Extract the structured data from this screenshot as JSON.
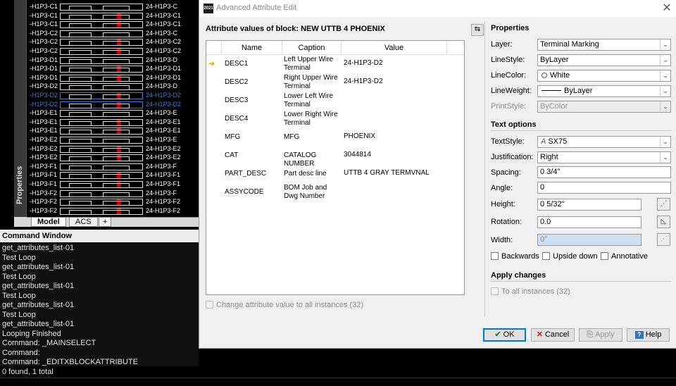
{
  "cad": {
    "rows": [
      {
        "left": "-H1P3-C1",
        "right": "24-H1P3-C"
      },
      {
        "left": "-H1P3-C1",
        "right": "24-H1P3-C1"
      },
      {
        "left": "-H1P3-C1",
        "right": "24-H1P3-C1"
      },
      {
        "left": "-H1P3-C2",
        "right": "24-H1P3-C"
      },
      {
        "left": "-H1P3-C2",
        "right": "24-H1P3-C2"
      },
      {
        "left": "-H1P3-C2",
        "right": "24-H1P3-C2"
      },
      {
        "left": "-H1P3-D1",
        "right": "24-H1P3-D"
      },
      {
        "left": "-H1P3-D1",
        "right": "24-H1P3-D1"
      },
      {
        "left": "-H1P3-D1",
        "right": "24-H1P3-D1"
      },
      {
        "left": "-H1P3-D2",
        "right": "24-H1P3-D"
      },
      {
        "left": "-H1P3-D2",
        "right": "24-H1P3-D2"
      },
      {
        "left": "-H1P3-D2",
        "right": "24-H1P3-D2"
      },
      {
        "left": "-H1P3-E1",
        "right": "24-H1P3-E"
      },
      {
        "left": "-H1P3-E1",
        "right": "24-H1P3-E1"
      },
      {
        "left": "-H1P3-E1",
        "right": "24-H1P3-E1"
      },
      {
        "left": "-H1P3-E2",
        "right": "24-H1P3-E"
      },
      {
        "left": "-H1P3-E2",
        "right": "24-H1P3-E2"
      },
      {
        "left": "-H1P3-E2",
        "right": "24-H1P3-E2"
      },
      {
        "left": "-H1P3-F1",
        "right": "24-H1P3-F"
      },
      {
        "left": "-H1P3-F1",
        "right": "24-H1P3-F1"
      },
      {
        "left": "-H1P3-F1",
        "right": "24-H1P3-F1"
      },
      {
        "left": "-H1P3-F2",
        "right": "24-H1P3-F"
      },
      {
        "left": "-H1P3-F2",
        "right": "24-H1P3-F2"
      },
      {
        "left": "-H1P3-F2",
        "right": "24-H1P3-F2"
      }
    ],
    "side_label": "Properties",
    "tabs": [
      "Model",
      "ACS",
      "+"
    ]
  },
  "command_window": {
    "title": "Command Window",
    "lines": [
      "get_attributes_list-01",
      "Test Loop",
      "get_attributes_list-01",
      "Test Loop",
      "get_attributes_list-01",
      "Test Loop",
      "get_attributes_list-01",
      "Test Loop",
      "get_attributes_list-01",
      "Looping Finished",
      "Command: _MAINSELECT",
      "Command:",
      "Command: _EDITXBLOCKATTRIBUTE",
      "0 found, 1 total"
    ]
  },
  "dialog": {
    "app_icon_text": "2021",
    "title": "Advanced Attribute Edit",
    "heading": "Attribute values of block: NEW UTTB 4 PHOENIX",
    "columns": [
      "Name",
      "Caption",
      "Value"
    ],
    "rows": [
      {
        "name": "DESC1",
        "caption": "Left Upper Wire Terminal",
        "value": "24-H1P3-D2"
      },
      {
        "name": "DESC2",
        "caption": "Right Upper Wire Terminal",
        "value": "24-H1P3-D2"
      },
      {
        "name": "DESC3",
        "caption": "Lower Left Wire Terminal",
        "value": ""
      },
      {
        "name": "DESC4",
        "caption": "Lower Right Wire Terminal",
        "value": ""
      },
      {
        "name": "MFG",
        "caption": "MFG",
        "value": "PHOENIX"
      },
      {
        "name": "CAT",
        "caption": "CATALOG NUMBER",
        "value": "3044814"
      },
      {
        "name": "PART_DESC",
        "caption": "Part desc line",
        "value": "UTTB 4 GRAY TERMVNAL"
      },
      {
        "name": "ASSYCODE",
        "caption": "BOM Job and Dwg Number",
        "value": ""
      }
    ],
    "change_all_label": "Change attribute value to all instances (32)",
    "properties": {
      "title": "Properties",
      "layer_label": "Layer:",
      "layer_value": "Terminal Marking",
      "linestyle_label": "LineStyle:",
      "linestyle_value": "ByLayer",
      "linecolor_label": "LineColor:",
      "linecolor_value": "White",
      "lineweight_label": "LineWeight:",
      "lineweight_value": "ByLayer",
      "printstyle_label": "PrintStyle:",
      "printstyle_value": "ByColor"
    },
    "text_options": {
      "title": "Text options",
      "textstyle_label": "TextStyle:",
      "textstyle_value": "SX75",
      "justification_label": "Justification:",
      "justification_value": "Right",
      "spacing_label": "Spacing:",
      "spacing_value": "0 3/4\"",
      "angle_label": "Angle:",
      "angle_value": "0",
      "height_label": "Height:",
      "height_value": "0 5/32\"",
      "rotation_label": "Rotation:",
      "rotation_value": "0.0",
      "width_label": "Width:",
      "width_value": "0\"",
      "backwards_label": "Backwards",
      "upside_down_label": "Upside down",
      "annotative_label": "Annotative"
    },
    "apply_changes": {
      "title": "Apply changes",
      "all_instances_label": "To all instances (32)"
    },
    "buttons": {
      "ok": "OK",
      "cancel": "Cancel",
      "apply": "Apply",
      "help": "Help"
    }
  }
}
